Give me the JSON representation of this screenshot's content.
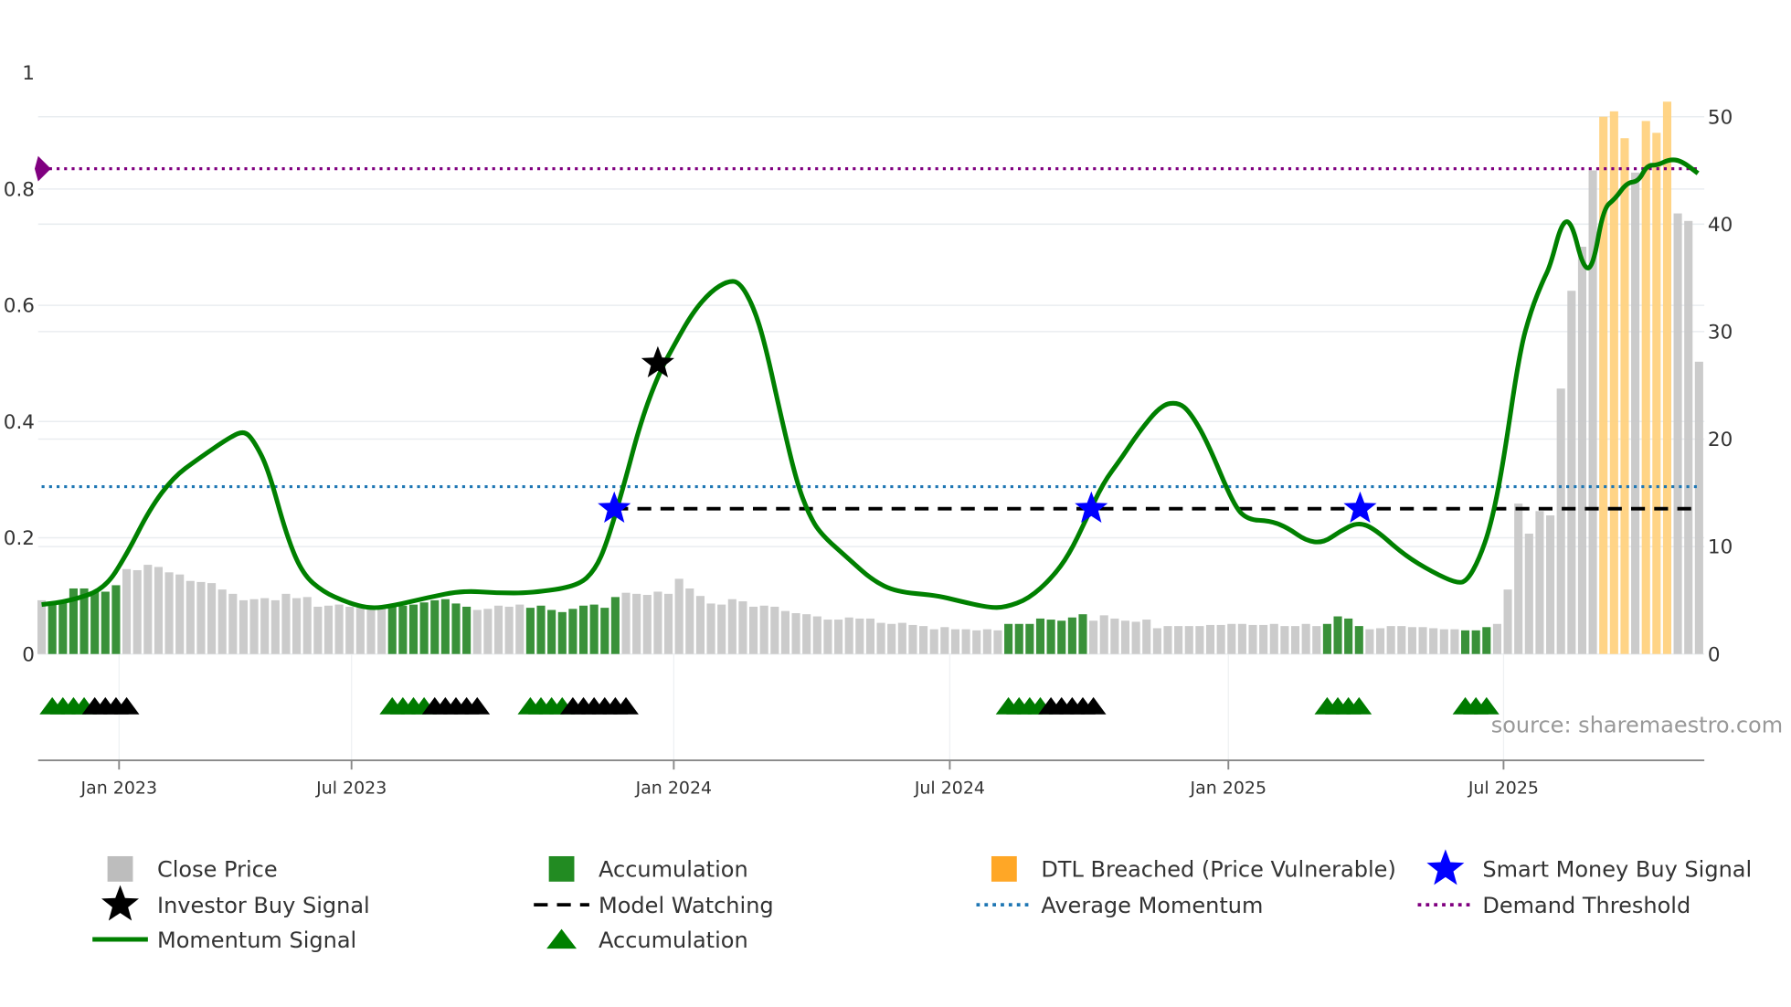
{
  "chart_data": {
    "type": "bar",
    "x_unit": "week index",
    "left_axis": {
      "ticks": [
        0,
        0.2,
        0.4,
        0.6,
        0.8,
        1
      ],
      "labels": [
        "0",
        "0.2",
        "0.4",
        "0.6",
        "0.8",
        "1"
      ]
    },
    "right_axis": {
      "ticks": [
        0,
        10,
        20,
        30,
        40,
        50
      ],
      "labels": [
        "0",
        "10",
        "20",
        "30",
        "40",
        "50"
      ]
    },
    "x_ticks": [
      {
        "label": "Jan 2023",
        "week": 7.29
      },
      {
        "label": "Jul 2023",
        "week": 29.17
      },
      {
        "label": "Jan 2024",
        "week": 59.5
      },
      {
        "label": "Jul 2024",
        "week": 85.48
      },
      {
        "label": "Jan 2025",
        "week": 111.7
      },
      {
        "label": "Jul 2025",
        "week": 137.6
      }
    ],
    "grid": true,
    "close_price": [
      5.0,
      4.7,
      4.8,
      6.1,
      6.1,
      5.8,
      5.8,
      6.4,
      7.9,
      7.8,
      8.3,
      8.1,
      7.6,
      7.4,
      6.8,
      6.7,
      6.6,
      6.0,
      5.6,
      5.0,
      5.1,
      5.2,
      5.0,
      5.6,
      5.2,
      5.3,
      4.4,
      4.5,
      4.6,
      4.4,
      4.3,
      4.2,
      4.2,
      4.4,
      4.5,
      4.6,
      4.8,
      5.0,
      5.1,
      4.7,
      4.4,
      4.1,
      4.2,
      4.5,
      4.4,
      4.6,
      4.3,
      4.5,
      4.1,
      3.9,
      4.2,
      4.5,
      4.6,
      4.3,
      5.3,
      5.7,
      5.6,
      5.5,
      5.8,
      5.6,
      7.0,
      6.1,
      5.4,
      4.7,
      4.6,
      5.1,
      4.9,
      4.4,
      4.5,
      4.4,
      4.0,
      3.8,
      3.7,
      3.5,
      3.2,
      3.2,
      3.4,
      3.3,
      3.3,
      2.9,
      2.8,
      2.9,
      2.7,
      2.6,
      2.3,
      2.5,
      2.3,
      2.3,
      2.2,
      2.3,
      2.2,
      2.8,
      2.8,
      2.8,
      3.3,
      3.2,
      3.1,
      3.4,
      3.7,
      3.1,
      3.6,
      3.3,
      3.1,
      3.0,
      3.2,
      2.4,
      2.6,
      2.6,
      2.6,
      2.6,
      2.7,
      2.7,
      2.8,
      2.8,
      2.7,
      2.7,
      2.8,
      2.6,
      2.6,
      2.8,
      2.6,
      2.8,
      3.5,
      3.3,
      2.6,
      2.3,
      2.4,
      2.6,
      2.6,
      2.5,
      2.5,
      2.4,
      2.3,
      2.3,
      2.2,
      2.2,
      2.5,
      2.8,
      6.0,
      14.0,
      11.2,
      13.3,
      12.9,
      24.7,
      33.8,
      37.9,
      45.0,
      50.0,
      50.5,
      48.0,
      44.8,
      49.6,
      48.5,
      51.4,
      41.0,
      40.3,
      27.2
    ],
    "bar_state_ranges": [
      {
        "state": "accumulation",
        "from": 1,
        "to": 7
      },
      {
        "state": "accumulation",
        "from": 33,
        "to": 40
      },
      {
        "state": "accumulation",
        "from": 46,
        "to": 54
      },
      {
        "state": "accumulation",
        "from": 91,
        "to": 98
      },
      {
        "state": "accumulation",
        "from": 121,
        "to": 124
      },
      {
        "state": "accumulation",
        "from": 134,
        "to": 136
      },
      {
        "state": "dtl",
        "from": 147,
        "to": 149
      },
      {
        "state": "dtl",
        "from": 151,
        "to": 153
      }
    ],
    "momentum": {
      "weeks": [
        0,
        2.6,
        5.9,
        8.0,
        10.2,
        12.4,
        14.6,
        17.8,
        19.1,
        20.0,
        21.3,
        23.1,
        24.6,
        26.5,
        28.7,
        30.9,
        33.1,
        36.3,
        39.6,
        42.8,
        46.1,
        50.5,
        52.1,
        53.2,
        54.8,
        56.4,
        58.1,
        59.7,
        61.3,
        63.0,
        64.6,
        65.7,
        67.0,
        68.1,
        69.7,
        71.1,
        72.2,
        73.3,
        76.0,
        78.2,
        80.4,
        84.2,
        86.4,
        89.1,
        90.7,
        92.9,
        95.1,
        96.7,
        98.3,
        99.9,
        101.6,
        103.2,
        105.4,
        107.0,
        108.1,
        109.7,
        112.2,
        113.5,
        115.7,
        117.3,
        119.0,
        120.6,
        122.2,
        123.9,
        125.5,
        128.2,
        130.9,
        133.3,
        134.2,
        135.3,
        136.4,
        137.5,
        139.1,
        140.2,
        141.3,
        142.0,
        143.1,
        144.0,
        145.1,
        146.0,
        147.0,
        148.1,
        149.2,
        150.3,
        151.1,
        152.1,
        153.2,
        154.3,
        155.9
      ],
      "values": [
        0.085,
        0.091,
        0.111,
        0.171,
        0.25,
        0.304,
        0.334,
        0.374,
        0.384,
        0.366,
        0.32,
        0.201,
        0.137,
        0.107,
        0.089,
        0.078,
        0.083,
        0.097,
        0.109,
        0.105,
        0.105,
        0.117,
        0.145,
        0.191,
        0.29,
        0.4,
        0.483,
        0.537,
        0.588,
        0.624,
        0.642,
        0.64,
        0.598,
        0.533,
        0.4,
        0.294,
        0.241,
        0.207,
        0.163,
        0.127,
        0.107,
        0.101,
        0.091,
        0.08,
        0.08,
        0.095,
        0.131,
        0.171,
        0.231,
        0.294,
        0.336,
        0.38,
        0.429,
        0.433,
        0.416,
        0.366,
        0.256,
        0.231,
        0.229,
        0.217,
        0.195,
        0.191,
        0.211,
        0.227,
        0.215,
        0.171,
        0.141,
        0.121,
        0.127,
        0.163,
        0.221,
        0.32,
        0.519,
        0.592,
        0.642,
        0.668,
        0.744,
        0.744,
        0.664,
        0.664,
        0.767,
        0.783,
        0.811,
        0.813,
        0.841,
        0.841,
        0.851,
        0.849,
        0.827
      ]
    },
    "average_momentum": 0.288,
    "demand_threshold": 0.835,
    "model_watching": {
      "value": 0.25,
      "from_week": 53.9,
      "to_week": 156
    },
    "investor_buy_signals": [
      {
        "week": 58.0,
        "value": 0.5
      }
    ],
    "smart_money_buy_signals": [
      {
        "week": 53.9,
        "value": 0.25
      },
      {
        "week": 98.8,
        "value": 0.25
      },
      {
        "week": 124.1,
        "value": 0.25
      }
    ],
    "triangle_markers": {
      "value": -0.09,
      "green": [
        1,
        2,
        3,
        4,
        33,
        34,
        35,
        36,
        46,
        47,
        48,
        49,
        91,
        92,
        93,
        94,
        121,
        122,
        123,
        124,
        134,
        135,
        136
      ],
      "black": [
        5,
        6,
        7,
        8,
        37,
        38,
        39,
        40,
        41,
        50,
        51,
        52,
        53,
        54,
        55,
        95,
        96,
        97,
        98,
        99
      ]
    },
    "legend": {
      "placement": "bottom",
      "items": [
        {
          "label": "Close Price",
          "symbol": "square",
          "color": "#bdbdbd"
        },
        {
          "label": "Accumulation",
          "symbol": "square",
          "color": "#228b22"
        },
        {
          "label": "DTL Breached (Price Vulnerable)",
          "symbol": "square",
          "color": "#ffa726"
        },
        {
          "label": "Smart Money Buy Signal",
          "symbol": "star",
          "color": "#0000ff"
        },
        {
          "label": "Investor Buy Signal",
          "symbol": "star",
          "color": "#000000"
        },
        {
          "label": "Model Watching",
          "symbol": "dash",
          "color": "#000000"
        },
        {
          "label": "Average Momentum",
          "symbol": "dot",
          "color": "#1f77b4"
        },
        {
          "label": "Demand Threshold",
          "symbol": "dot",
          "color": "#800080"
        },
        {
          "label": "Momentum Signal",
          "symbol": "line",
          "color": "#008000"
        },
        {
          "label": "Accumulation",
          "symbol": "triangle",
          "color": "#008000"
        }
      ]
    },
    "annotation": "source: sharemaestro.com",
    "colors": {
      "gray": "#c8c8c8",
      "green_bar": "#2e8b2e",
      "dtl_bar": "#ffd27f",
      "momentum": "#008000",
      "avg": "#1f77b4",
      "demand": "#800080",
      "grid": "#e9edf0"
    }
  }
}
